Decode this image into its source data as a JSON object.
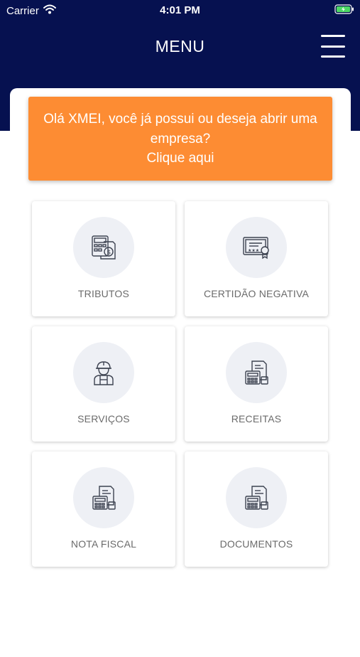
{
  "status_bar": {
    "carrier": "Carrier",
    "time": "4:01 PM"
  },
  "header": {
    "title": "MENU",
    "menu_icon": "hamburger-menu-icon"
  },
  "banner": {
    "text": "Olá XMEI, você já possui ou deseja abrir uma empresa?",
    "cta": "Clique aqui",
    "color": "#fd8c33"
  },
  "colors": {
    "header_bg": "#061150",
    "card_icon_bg": "#eef0f5"
  },
  "cards": [
    {
      "label": "TRIBUTOS",
      "icon": "tax-calculator-icon"
    },
    {
      "label": "CERTIDÃO NEGATIVA",
      "icon": "certificate-icon"
    },
    {
      "label": "SERVIÇOS",
      "icon": "worker-icon"
    },
    {
      "label": "RECEITAS",
      "icon": "receipt-calculator-icon"
    },
    {
      "label": "NOTA FISCAL",
      "icon": "invoice-calculator-icon"
    },
    {
      "label": "DOCUMENTOS",
      "icon": "documents-calculator-icon"
    }
  ]
}
